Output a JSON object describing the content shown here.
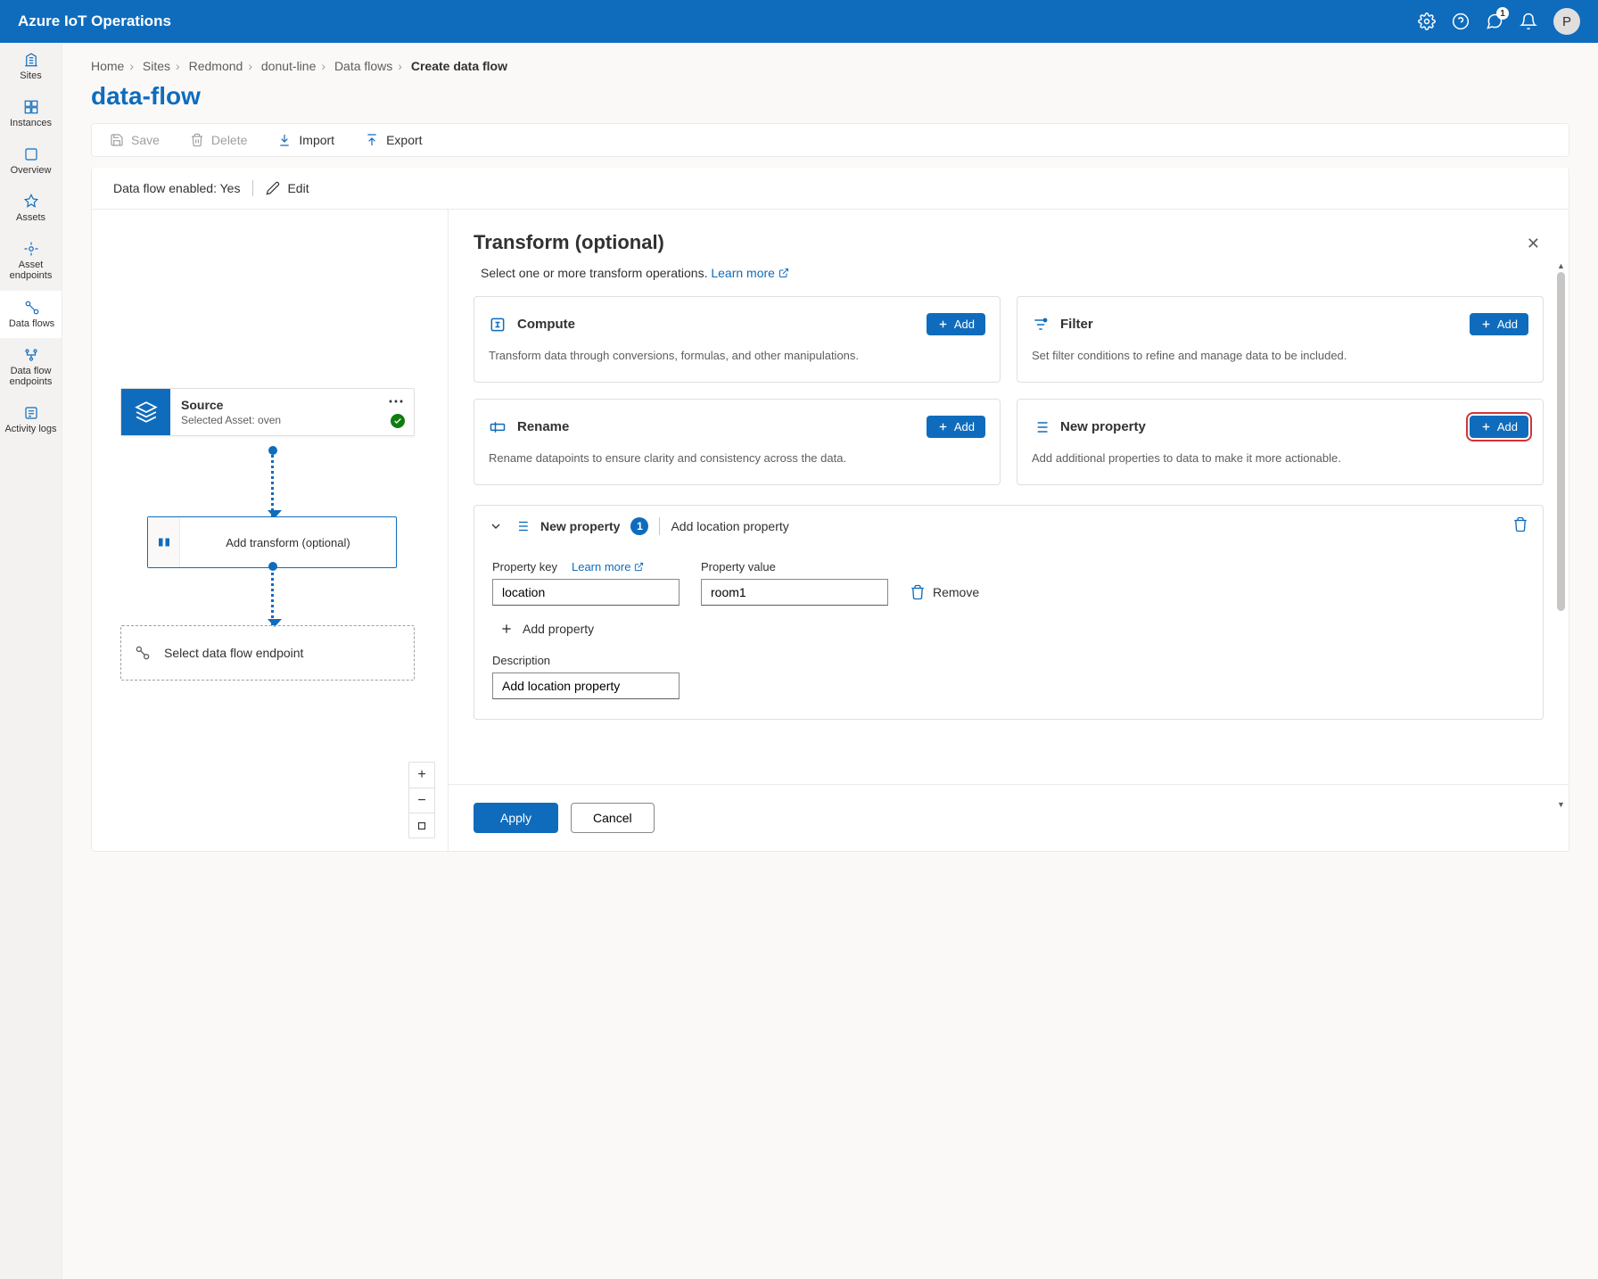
{
  "topbar": {
    "title": "Azure IoT Operations",
    "notif_count": "1",
    "avatar_initial": "P"
  },
  "nav": {
    "items": [
      {
        "label": "Sites"
      },
      {
        "label": "Instances"
      },
      {
        "label": "Overview"
      },
      {
        "label": "Assets"
      },
      {
        "label": "Asset endpoints"
      },
      {
        "label": "Data flows"
      },
      {
        "label": "Data flow endpoints"
      },
      {
        "label": "Activity logs"
      }
    ]
  },
  "breadcrumb": {
    "items": [
      "Home",
      "Sites",
      "Redmond",
      "donut-line",
      "Data flows"
    ],
    "current": "Create data flow"
  },
  "page": {
    "title": "data-flow"
  },
  "toolbar": {
    "save": "Save",
    "delete": "Delete",
    "import": "Import",
    "export": "Export"
  },
  "status": {
    "label": "Data flow enabled: Yes",
    "edit": "Edit"
  },
  "canvas": {
    "source": {
      "title": "Source",
      "subtitle": "Selected Asset: oven"
    },
    "transform": {
      "label": "Add transform (optional)"
    },
    "endpoint": {
      "label": "Select data flow endpoint"
    }
  },
  "panel": {
    "title": "Transform (optional)",
    "subtitle": "Select one or more transform operations.",
    "learn_more": "Learn more",
    "ops": {
      "compute": {
        "title": "Compute",
        "desc": "Transform data through conversions, formulas, and other manipulations.",
        "add": "Add"
      },
      "filter": {
        "title": "Filter",
        "desc": "Set filter conditions to refine and manage data to be included.",
        "add": "Add"
      },
      "rename": {
        "title": "Rename",
        "desc": "Rename datapoints to ensure clarity and consistency across the data.",
        "add": "Add"
      },
      "newprop": {
        "title": "New property",
        "desc": "Add additional properties to data to make it more actionable.",
        "add": "Add"
      }
    },
    "section": {
      "title": "New property",
      "count": "1",
      "subtitle": "Add location property",
      "key_label": "Property key",
      "learn_more": "Learn more",
      "val_label": "Property value",
      "key_value": "location",
      "val_value": "room1",
      "remove": "Remove",
      "add_property": "Add property",
      "desc_label": "Description",
      "desc_value": "Add location property"
    },
    "footer": {
      "apply": "Apply",
      "cancel": "Cancel"
    }
  }
}
